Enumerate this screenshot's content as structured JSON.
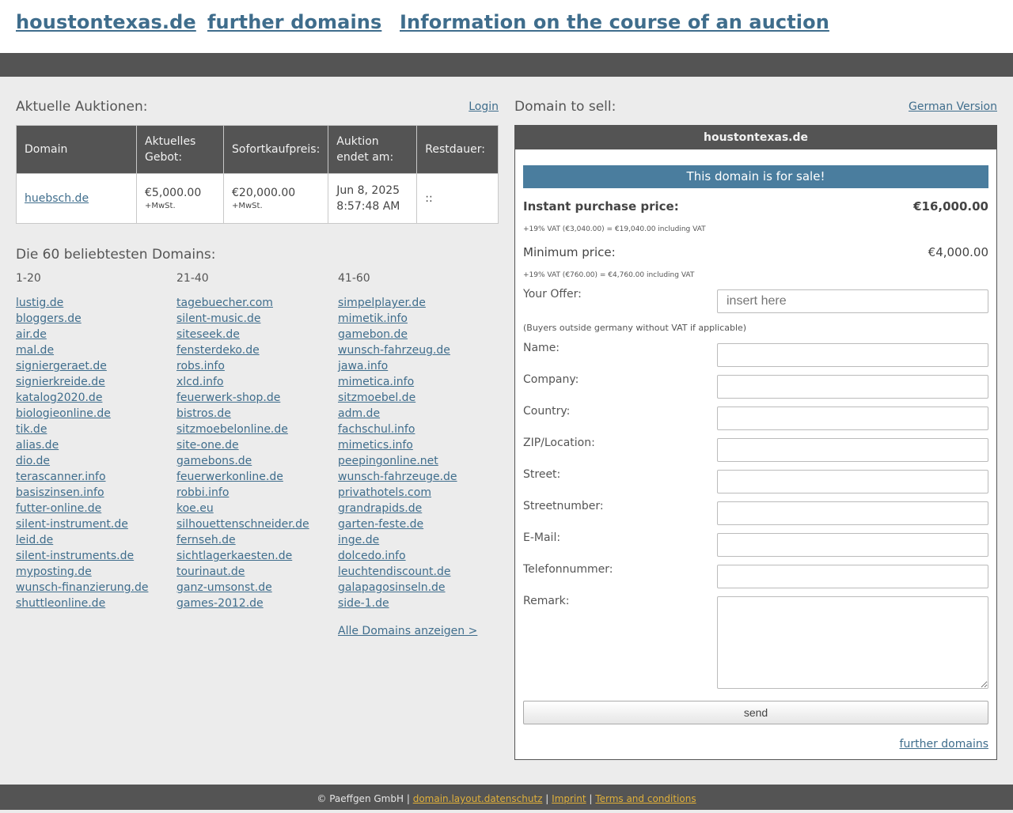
{
  "header": {
    "site_link": "houstontexas.de",
    "further_link": "further domains",
    "info_link": "Information on the course of an auction"
  },
  "auctions": {
    "title": "Aktuelle Auktionen:",
    "login": "Login",
    "columns": [
      "Domain",
      "Aktuelles Gebot:",
      "Sofortkaufpreis:",
      "Auktion endet am:",
      "Restdauer:"
    ],
    "rows": [
      {
        "domain": "huebsch.de",
        "bid": "€5,000.00",
        "bid_tax": "+MwSt.",
        "buy_now": "€20,000.00",
        "buy_now_tax": "+MwSt.",
        "ends": "Jun 8, 2025 8:57:48 AM",
        "remaining": "::"
      }
    ]
  },
  "popular": {
    "title": "Die 60 beliebtesten Domains:",
    "col1_head": "1-20",
    "col2_head": "21-40",
    "col3_head": "41-60",
    "col1": [
      "lustig.de",
      "bloggers.de",
      "air.de",
      "mal.de",
      "signiergeraet.de",
      "signierkreide.de",
      "katalog2020.de",
      "biologieonline.de",
      "tik.de",
      "alias.de",
      "dio.de",
      "terascanner.info",
      "basiszinsen.info",
      "futter-online.de",
      "silent-instrument.de",
      "leid.de",
      "silent-instruments.de",
      "myposting.de",
      "wunsch-finanzierung.de",
      "shuttleonline.de"
    ],
    "col2": [
      "tagebuecher.com",
      "silent-music.de",
      "siteseek.de",
      "fensterdeko.de",
      "robs.info",
      "xlcd.info",
      "feuerwerk-shop.de",
      "bistros.de",
      "sitzmoebelonline.de",
      "site-one.de",
      "gamebons.de",
      "feuerwerkonline.de",
      "robbi.info",
      "koe.eu",
      "silhouettenschneider.de",
      "fernseh.de",
      "sichtlagerkaesten.de",
      "tourinaut.de",
      "ganz-umsonst.de",
      "games-2012.de"
    ],
    "col3": [
      "simpelplayer.de",
      "mimetik.info",
      "gamebon.de",
      "wunsch-fahrzeug.de",
      "jawa.info",
      "mimetica.info",
      "sitzmoebel.de",
      "adm.de",
      "fachschul.info",
      "mimetics.info",
      "peepingonline.net",
      "wunsch-fahrzeuge.de",
      "privathotels.com",
      "grandrapids.de",
      "garten-feste.de",
      "inge.de",
      "dolcedo.info",
      "leuchtendiscount.de",
      "galapagosinseln.de",
      "side-1.de"
    ],
    "all_link": "Alle Domains anzeigen >"
  },
  "sell": {
    "title": "Domain to sell:",
    "german_link": "German Version",
    "box_title": "houstontexas.de",
    "sale_banner": "This domain is for sale!",
    "instant_label": "Instant purchase price:",
    "instant_value": "€16,000.00",
    "instant_vat": "+19% VAT (€3,040.00) = €19,040.00 including VAT",
    "min_label": "Minimum price:",
    "min_value": "€4,000.00",
    "min_vat": "+19% VAT (€760.00) = €4,760.00 including VAT",
    "offer_label": "Your Offer:",
    "offer_placeholder": "insert here",
    "buyers_note": "(Buyers outside germany without VAT if applicable)",
    "name_label": "Name:",
    "company_label": "Company:",
    "country_label": "Country:",
    "zip_label": "ZIP/Location:",
    "street_label": "Street:",
    "streetnumber_label": "Streetnumber:",
    "email_label": "E-Mail:",
    "phone_label": "Telefonnummer:",
    "remark_label": "Remark:",
    "send_label": "send",
    "further_link": "further domains"
  },
  "footer": {
    "copyright": "© Paeffgen GmbH",
    "sep": "|",
    "privacy": "domain.layout.datenschutz",
    "imprint": "Imprint",
    "terms": "Terms and conditions"
  }
}
